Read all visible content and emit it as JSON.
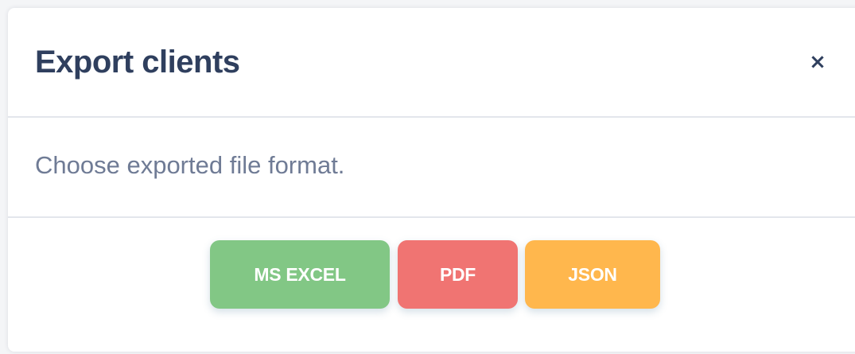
{
  "modal": {
    "title": "Export clients",
    "close_label": "×",
    "message": "Choose exported file format.",
    "buttons": {
      "excel": "MS EXCEL",
      "pdf": "PDF",
      "json": "JSON"
    }
  },
  "colors": {
    "title": "#2f3f5e",
    "message": "#6f7b95",
    "excel": "#82c785",
    "pdf": "#f07472",
    "json": "#ffb74d"
  },
  "icons": {
    "close": "close-icon"
  }
}
